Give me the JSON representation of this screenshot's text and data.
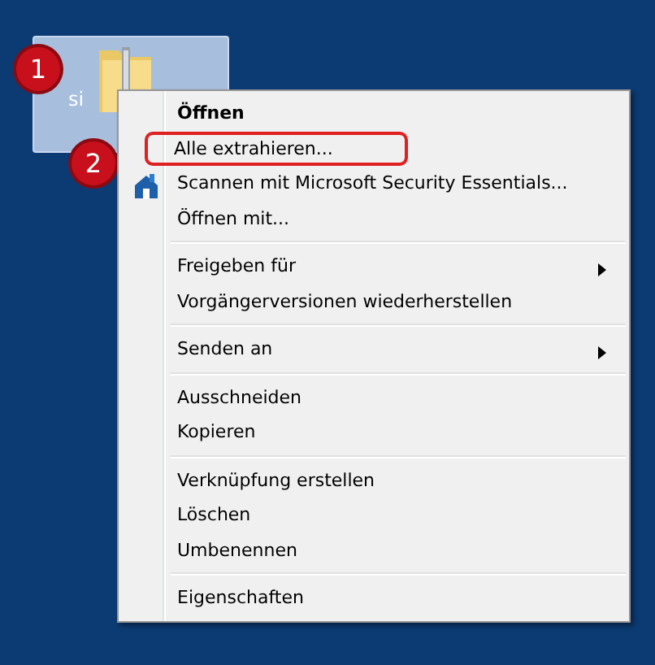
{
  "desktop_icon": {
    "label": "si",
    "selected": true
  },
  "callouts": [
    "1",
    "2"
  ],
  "context_menu": {
    "groups": [
      {
        "items": [
          {
            "label": "Öffnen",
            "default": true,
            "submenu": false,
            "highlighted": false,
            "icon": false
          },
          {
            "label": "Alle extrahieren...",
            "default": false,
            "submenu": false,
            "highlighted": true,
            "icon": false
          },
          {
            "label": "Scannen mit Microsoft Security Essentials...",
            "default": false,
            "submenu": false,
            "highlighted": false,
            "icon": true
          },
          {
            "label": "Öffnen mit...",
            "default": false,
            "submenu": false,
            "highlighted": false,
            "icon": false
          }
        ]
      },
      {
        "items": [
          {
            "label": "Freigeben für",
            "default": false,
            "submenu": true,
            "highlighted": false,
            "icon": false
          },
          {
            "label": "Vorgängerversionen wiederherstellen",
            "default": false,
            "submenu": false,
            "highlighted": false,
            "icon": false
          }
        ]
      },
      {
        "items": [
          {
            "label": "Senden an",
            "default": false,
            "submenu": true,
            "highlighted": false,
            "icon": false
          }
        ]
      },
      {
        "items": [
          {
            "label": "Ausschneiden",
            "default": false,
            "submenu": false,
            "highlighted": false,
            "icon": false
          },
          {
            "label": "Kopieren",
            "default": false,
            "submenu": false,
            "highlighted": false,
            "icon": false
          }
        ]
      },
      {
        "items": [
          {
            "label": "Verknüpfung erstellen",
            "default": false,
            "submenu": false,
            "highlighted": false,
            "icon": false
          },
          {
            "label": "Löschen",
            "default": false,
            "submenu": false,
            "highlighted": false,
            "icon": false
          },
          {
            "label": "Umbenennen",
            "default": false,
            "submenu": false,
            "highlighted": false,
            "icon": false
          }
        ]
      },
      {
        "items": [
          {
            "label": "Eigenschaften",
            "default": false,
            "submenu": false,
            "highlighted": false,
            "icon": false
          }
        ]
      }
    ]
  }
}
